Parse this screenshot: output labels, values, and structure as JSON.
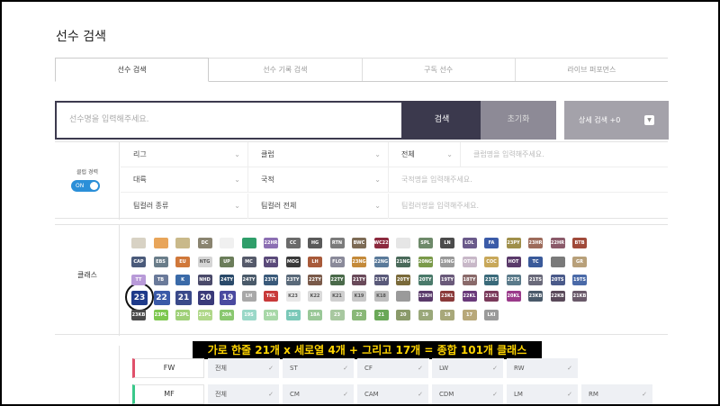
{
  "page": {
    "title": "선수 검색"
  },
  "tabs": [
    "선수 검색",
    "선수 기록 검색",
    "구독 선수",
    "라이브 퍼포먼스"
  ],
  "search": {
    "placeholder": "선수명을 입력해주세요.",
    "search_label": "검색",
    "reset_label": "초기화",
    "detail_label": "상세 검색 +0",
    "detail_icon": "chevron-down-icon"
  },
  "filters": {
    "club_career_label": "클럽 경력",
    "toggle_label": "ON",
    "league": "리그",
    "club": "클럽",
    "all": "전체",
    "club_placeholder": "클럽명을 입력해주세요.",
    "continent": "대륙",
    "nationality": "국적",
    "nation_placeholder": "국적명을 입력해주세요.",
    "teamcolor_type": "팀컬러 종류",
    "teamcolor_all": "팀컬러 전체",
    "teamcolor_placeholder": "팀컬러명을 입력해주세요."
  },
  "class_section": {
    "label": "클래스",
    "rows": [
      [
        {
          "t": "",
          "c": "#d8d2c4"
        },
        {
          "t": "",
          "c": "#e8a55a"
        },
        {
          "t": "",
          "c": "#c9b98a"
        },
        {
          "t": "DC",
          "c": "#8a8470"
        },
        {
          "t": "",
          "c": "#f0f0f0"
        },
        {
          "t": "",
          "c": "#2f9e6a"
        },
        {
          "t": "22HR",
          "c": "#8c6fb3"
        },
        {
          "t": "CC",
          "c": "#6b6b6b"
        },
        {
          "t": "HG",
          "c": "#5a5a5a"
        },
        {
          "t": "RTN",
          "c": "#7b7b7b"
        },
        {
          "t": "BWC",
          "c": "#7d6b55"
        },
        {
          "t": "WC22",
          "c": "#8c2a3e"
        },
        {
          "t": "",
          "c": "#e6e6e6"
        },
        {
          "t": "SPL",
          "c": "#6e8a6a"
        },
        {
          "t": "LN",
          "c": "#4b4b4b"
        },
        {
          "t": "LOL",
          "c": "#6a5a8a"
        },
        {
          "t": "FA",
          "c": "#3b5ba8"
        },
        {
          "t": "23PY",
          "c": "#9f8f4a"
        },
        {
          "t": "23HR",
          "c": "#9d6b5b"
        },
        {
          "t": "22HR",
          "c": "#8b5a6a"
        },
        {
          "t": "BTB",
          "c": "#a04a3a"
        }
      ],
      [
        {
          "t": "CAP",
          "c": "#4a5a7a"
        },
        {
          "t": "EBS",
          "c": "#6a7d8a"
        },
        {
          "t": "EU",
          "c": "#d0783a"
        },
        {
          "t": "NTG",
          "c": "#d5d5d5"
        },
        {
          "t": "UP",
          "c": "#6b7d5a"
        },
        {
          "t": "MC",
          "c": "#555a6a"
        },
        {
          "t": "VTR",
          "c": "#5a4a7a"
        },
        {
          "t": "MOG",
          "c": "#3a3a3a"
        },
        {
          "t": "LH",
          "c": "#a85a3a"
        },
        {
          "t": "FLO",
          "c": "#8a8a9a"
        },
        {
          "t": "23NG",
          "c": "#c48a3a"
        },
        {
          "t": "22NG",
          "c": "#5a7a9a"
        },
        {
          "t": "21NG",
          "c": "#4a6a5a"
        },
        {
          "t": "20NG",
          "c": "#7a9a4a"
        },
        {
          "t": "19NG",
          "c": "#9a9a9a"
        },
        {
          "t": "OTW",
          "c": "#c8b8c8"
        },
        {
          "t": "COC",
          "c": "#c8a85a"
        },
        {
          "t": "HOT",
          "c": "#5a3a6a"
        },
        {
          "t": "TC",
          "c": "#3a5a9a"
        },
        {
          "t": "",
          "c": "#7a7a7a"
        },
        {
          "t": "GR",
          "c": "#b8a07a"
        }
      ],
      [
        {
          "t": "TT",
          "c": "#b89ad8"
        },
        {
          "t": "TB",
          "c": "#6a7a9a"
        },
        {
          "t": "K",
          "c": "#3a6aa8"
        },
        {
          "t": "NHD",
          "c": "#4a4a6a"
        },
        {
          "t": "24TY",
          "c": "#2a4a6a"
        },
        {
          "t": "24TY",
          "c": "#4a5a6a"
        },
        {
          "t": "23TY",
          "c": "#3a5a7a"
        },
        {
          "t": "23TY",
          "c": "#5a6a7a"
        },
        {
          "t": "22TY",
          "c": "#7a5a4a"
        },
        {
          "t": "22TY",
          "c": "#4a6a4a"
        },
        {
          "t": "21TY",
          "c": "#6a4a5a"
        },
        {
          "t": "21TY",
          "c": "#5a5a7a"
        },
        {
          "t": "20TY",
          "c": "#7a6a3a"
        },
        {
          "t": "20TY",
          "c": "#4a7a6a"
        },
        {
          "t": "19TY",
          "c": "#6a5a7a"
        },
        {
          "t": "18TY",
          "c": "#8a6a6a"
        },
        {
          "t": "23TS",
          "c": "#3a6a7a"
        },
        {
          "t": "22TS",
          "c": "#5a7a8a"
        },
        {
          "t": "21TS",
          "c": "#6a6a7a"
        },
        {
          "t": "20TS",
          "c": "#4a5a8a"
        },
        {
          "t": "19TS",
          "c": "#4a6aa8"
        }
      ],
      [
        {
          "t": "23",
          "c": "#1e3a8a",
          "big": true
        },
        {
          "t": "22",
          "c": "#3a5aa8",
          "big": true
        },
        {
          "t": "21",
          "c": "#3a4a8a",
          "big": true
        },
        {
          "t": "20",
          "c": "#3a3a7a",
          "big": true
        },
        {
          "t": "19",
          "c": "#4a4aa0",
          "big": true
        },
        {
          "t": "LH",
          "c": "#a8a8a8"
        },
        {
          "t": "TKL",
          "c": "#c83a3a"
        },
        {
          "t": "K23",
          "c": "#e8e8e8"
        },
        {
          "t": "K22",
          "c": "#dadada"
        },
        {
          "t": "K21",
          "c": "#cfcfcf"
        },
        {
          "t": "K19",
          "c": "#c8c8c8"
        },
        {
          "t": "K18",
          "c": "#bebebe"
        },
        {
          "t": "",
          "c": "#9a9a9a"
        },
        {
          "t": "12KH",
          "c": "#5a3a6a"
        },
        {
          "t": "23KL",
          "c": "#8a3a3a"
        },
        {
          "t": "22KL",
          "c": "#6a3a7a"
        },
        {
          "t": "21KL",
          "c": "#7a3a5a"
        },
        {
          "t": "20KL",
          "c": "#9a3a8a"
        },
        {
          "t": "23KB",
          "c": "#4a5a6a"
        },
        {
          "t": "22KB",
          "c": "#5a4a5a"
        },
        {
          "t": "21KB",
          "c": "#6a5a6a"
        }
      ],
      [
        {
          "t": "23KB",
          "c": "#4a4a4a"
        },
        {
          "t": "23PL",
          "c": "#7ec850"
        },
        {
          "t": "22PL",
          "c": "#9fd078"
        },
        {
          "t": "21PL",
          "c": "#b0d88a"
        },
        {
          "t": "20A",
          "c": "#8ac870"
        },
        {
          "t": "19S",
          "c": "#9ad8c8"
        },
        {
          "t": "19A",
          "c": "#a8d8a8"
        },
        {
          "t": "18S",
          "c": "#7ac8b8"
        },
        {
          "t": "18A",
          "c": "#9ac898"
        },
        {
          "t": "23",
          "c": "#a8c8a0"
        },
        {
          "t": "22",
          "c": "#8ab878"
        },
        {
          "t": "21",
          "c": "#6aa858"
        },
        {
          "t": "20",
          "c": "#8a9a6a"
        },
        {
          "t": "19",
          "c": "#9aa87a"
        },
        {
          "t": "18",
          "c": "#a8a87a"
        },
        {
          "t": "17",
          "c": "#b8a87a"
        },
        {
          "t": "LKI",
          "c": "#9a9a9a"
        }
      ]
    ]
  },
  "caption": "가로 한줄 21개 x 세로열 4개 + 그리고 17개 = 종합 101개 클래스",
  "positions": [
    {
      "label": "FW",
      "color": "#e0506a",
      "chips": [
        "전체",
        "ST",
        "CF",
        "LW",
        "RW"
      ]
    },
    {
      "label": "MF",
      "color": "#3ac88a",
      "chips": [
        "전체",
        "CM",
        "CAM",
        "CDM",
        "LM",
        "RM"
      ]
    }
  ]
}
